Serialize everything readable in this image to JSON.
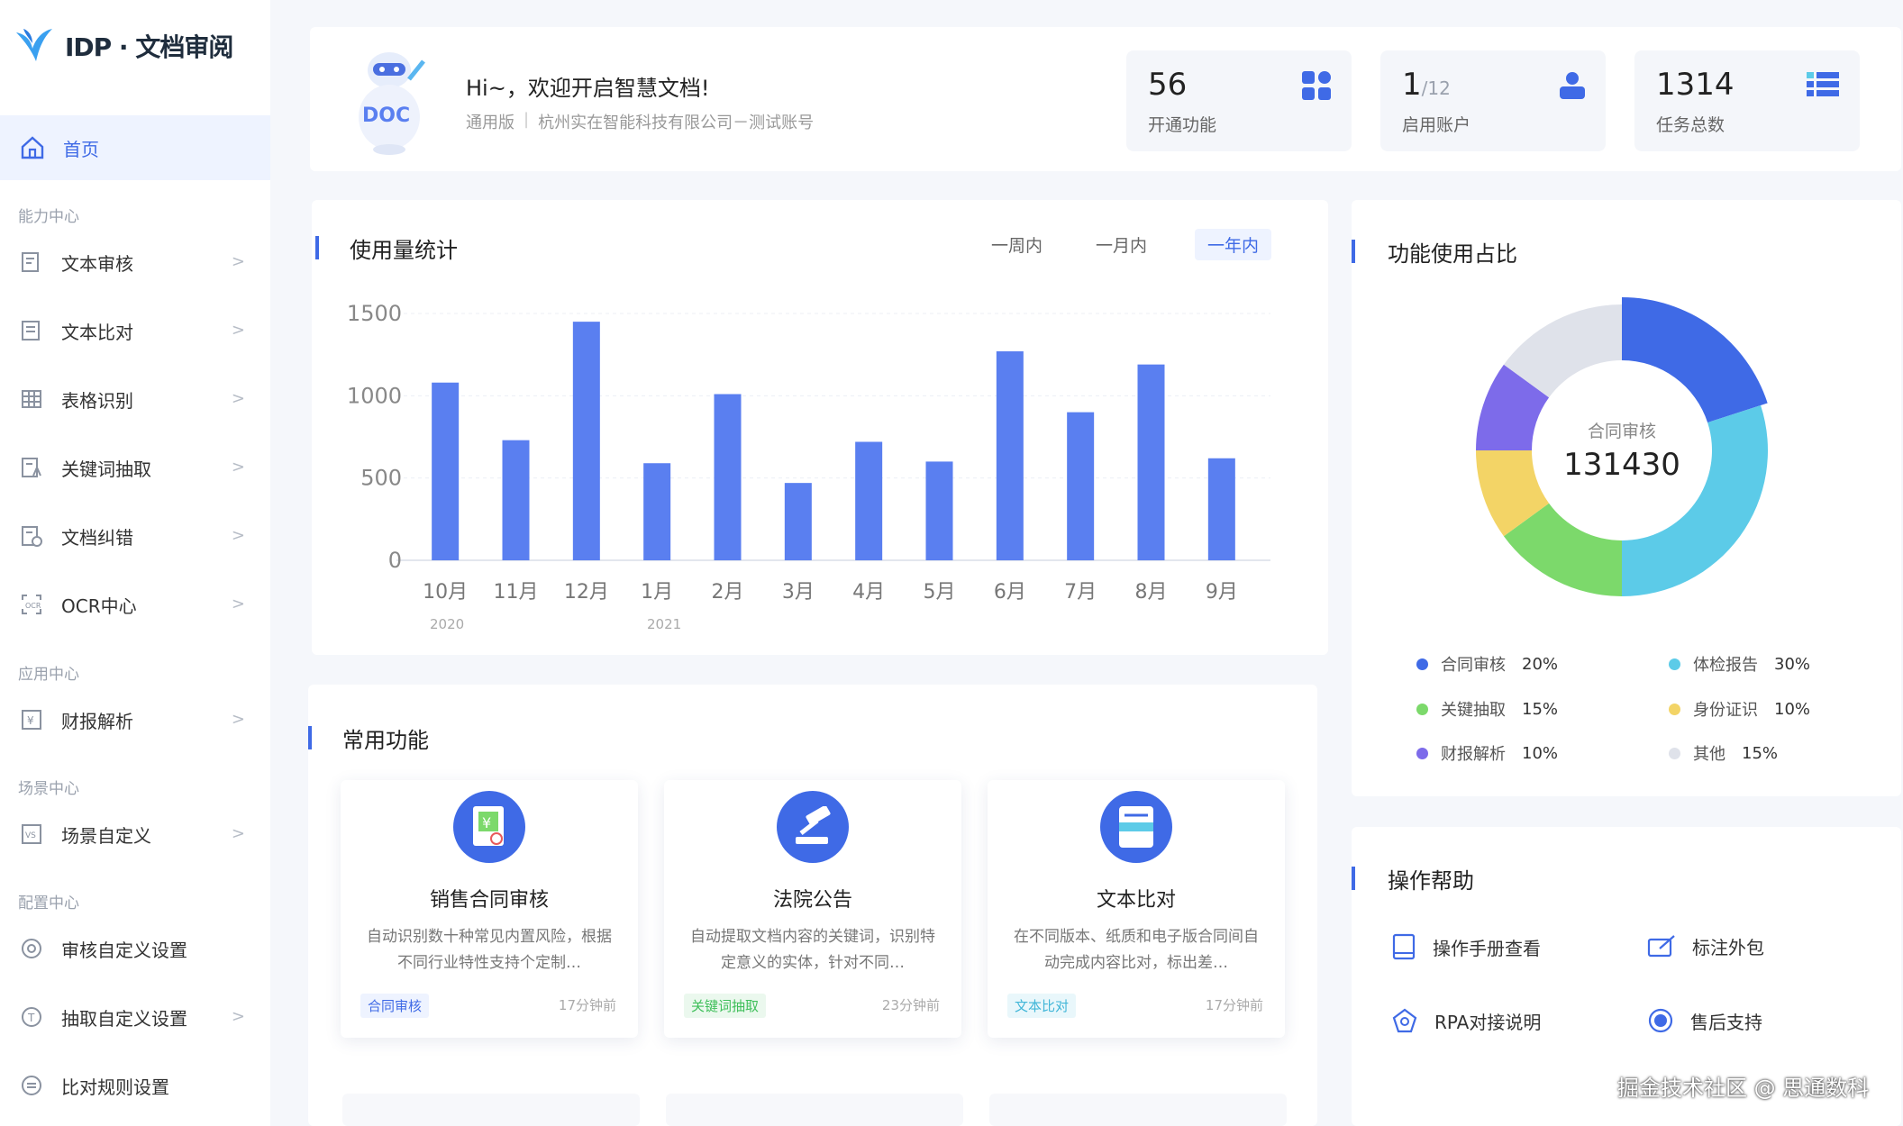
{
  "app": {
    "title": "IDP · 文档审阅"
  },
  "sidebar": {
    "home": "首页",
    "sections": [
      "能力中心",
      "应用中心",
      "场景中心",
      "配置中心"
    ],
    "ability_items": [
      {
        "label": "文本审核",
        "icon": "doc-review-icon"
      },
      {
        "label": "文本比对",
        "icon": "doc-compare-icon"
      },
      {
        "label": "表格识别",
        "icon": "table-icon"
      },
      {
        "label": "关键词抽取",
        "icon": "keyword-icon"
      },
      {
        "label": "文档纠错",
        "icon": "doc-correct-icon"
      },
      {
        "label": "OCR中心",
        "icon": "ocr-icon"
      }
    ],
    "app_items": [
      {
        "label": "财报解析",
        "icon": "finance-icon"
      }
    ],
    "scene_items": [
      {
        "label": "场景自定义",
        "icon": "scene-icon"
      }
    ],
    "config_items": [
      {
        "label": "审核自定义设置",
        "icon": "review-setting-icon"
      },
      {
        "label": "抽取自定义设置",
        "icon": "extract-setting-icon"
      },
      {
        "label": "比对规则设置",
        "icon": "compare-rule-icon"
      }
    ]
  },
  "banner": {
    "greeting": "Hi~，欢迎开启智慧文档!",
    "edition": "通用版",
    "company": "杭州实在智能科技有限公司－测试账号",
    "robot_badge": "DOC",
    "stats": [
      {
        "value": "56",
        "sub": "",
        "label": "开通功能",
        "icon": "grid-icon"
      },
      {
        "value": "1",
        "sub": "/12",
        "label": "启用账户",
        "icon": "user-icon"
      },
      {
        "value": "1314",
        "sub": "",
        "label": "任务总数",
        "icon": "task-list-icon"
      }
    ]
  },
  "usage": {
    "title": "使用量统计",
    "ranges": [
      "一周内",
      "一月内",
      "一年内"
    ],
    "active_range": "一年内",
    "year_labels": [
      "2020",
      "2021"
    ]
  },
  "chart_data": {
    "type": "bar",
    "categories": [
      "10月",
      "11月",
      "12月",
      "1月",
      "2月",
      "3月",
      "4月",
      "5月",
      "6月",
      "7月",
      "8月",
      "9月"
    ],
    "values": [
      1080,
      730,
      1450,
      590,
      1010,
      470,
      720,
      600,
      1270,
      900,
      1190,
      620
    ],
    "yticks": [
      1500,
      1000,
      500,
      0
    ],
    "ylim": [
      0,
      1500
    ],
    "color": "#5a7ff0"
  },
  "pie": {
    "title": "功能使用占比",
    "center_label": "合同审核",
    "center_value": "131430",
    "slices": [
      {
        "name": "合同审核",
        "pct": "20%",
        "value": 20,
        "color": "#3f6ae6"
      },
      {
        "name": "体检报告",
        "pct": "30%",
        "value": 30,
        "color": "#5ccbe8"
      },
      {
        "name": "关键抽取",
        "pct": "15%",
        "value": 15,
        "color": "#7cd96b"
      },
      {
        "name": "身份证识",
        "pct": "10%",
        "value": 10,
        "color": "#f3d466"
      },
      {
        "name": "财报解析",
        "pct": "10%",
        "value": 10,
        "color": "#7d6bea"
      },
      {
        "name": "其他",
        "pct": "15%",
        "value": 15,
        "color": "#dfe2ea"
      }
    ]
  },
  "functions": {
    "title": "常用功能",
    "cards": [
      {
        "name": "销售合同审核",
        "desc": "自动识别数十种常见内置风险，根据不同行业特性支持个定制…",
        "tag": "合同审核",
        "time": "17分钟前",
        "icon": "contract-icon"
      },
      {
        "name": "法院公告",
        "desc": "自动提取文档内容的关键词，识别特定意义的实体，针对不同…",
        "tag": "关键词抽取",
        "time": "23分钟前",
        "icon": "gavel-icon"
      },
      {
        "name": "文本比对",
        "desc": "在不同版本、纸质和电子版合同间自动完成内容比对，标出差…",
        "tag": "文本比对",
        "time": "17分钟前",
        "icon": "compare-doc-icon"
      }
    ]
  },
  "help": {
    "title": "操作帮助",
    "items": [
      {
        "label": "操作手册查看",
        "icon": "manual-icon"
      },
      {
        "label": "标注外包",
        "icon": "annotate-icon"
      },
      {
        "label": "RPA对接说明",
        "icon": "rpa-icon"
      },
      {
        "label": "售后支持",
        "icon": "support-icon"
      }
    ]
  },
  "watermark": "掘金技术社区 @ 思通数科"
}
